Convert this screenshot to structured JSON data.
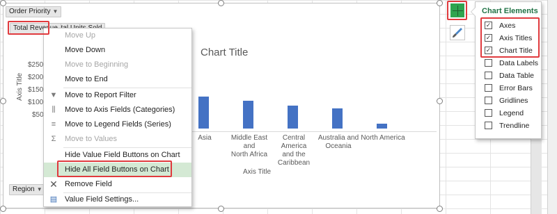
{
  "chart": {
    "title": "Chart Title",
    "y_axis_title": "Axis Title",
    "x_axis_title": "Axis Title",
    "y_ticks": [
      "$250",
      "$200",
      "$150",
      "$100",
      "$50"
    ],
    "field_buttons": {
      "order_priority": "Order Priority",
      "total_revenue": "Total Revenue",
      "total_units_sold": "Total Units Sold",
      "region": "Region"
    }
  },
  "chart_data": {
    "type": "bar",
    "title": "Chart Title",
    "xlabel": "Axis Title",
    "ylabel": "Axis Title",
    "categories": [
      "Asia",
      "Middle East and North Africa",
      "Central America and the Caribbean",
      "Australia and Oceania",
      "North America"
    ],
    "category_lines": [
      [
        "Asia"
      ],
      [
        "Middle East and",
        "North Africa"
      ],
      [
        "Central America",
        "and the",
        "Caribbean"
      ],
      [
        "Australia and",
        "Oceania"
      ],
      [
        "North America"
      ]
    ],
    "values": [
      120,
      105,
      85,
      75,
      18
    ],
    "ylim": [
      0,
      300
    ]
  },
  "context_menu": {
    "items": [
      {
        "label": "Move Up",
        "icon": "",
        "disabled": true
      },
      {
        "label": "Move Down",
        "icon": "",
        "disabled": false
      },
      {
        "label": "Move to Beginning",
        "icon": "",
        "disabled": true
      },
      {
        "label": "Move to End",
        "icon": "",
        "disabled": false
      },
      {
        "label": "Move to Report Filter",
        "icon": "filter-icon",
        "disabled": false
      },
      {
        "label": "Move to Axis Fields (Categories)",
        "icon": "axis-fields-icon",
        "disabled": false
      },
      {
        "label": "Move to Legend Fields (Series)",
        "icon": "legend-fields-icon",
        "disabled": false
      },
      {
        "label": "Move to Values",
        "icon": "sigma-icon",
        "disabled": true
      },
      {
        "label": "Hide Value Field Buttons on Chart",
        "icon": "",
        "disabled": false
      },
      {
        "label": "Hide All Field Buttons on Chart",
        "icon": "",
        "disabled": false,
        "highlighted": true
      },
      {
        "label": "Remove Field",
        "icon": "remove-icon",
        "disabled": false
      },
      {
        "label": "Value Field Settings...",
        "icon": "field-settings-icon",
        "disabled": false
      }
    ]
  },
  "chart_elements_panel": {
    "title": "Chart Elements",
    "items": [
      {
        "label": "Axes",
        "checked": true
      },
      {
        "label": "Axis Titles",
        "checked": true
      },
      {
        "label": "Chart Title",
        "checked": true
      },
      {
        "label": "Data Labels",
        "checked": false
      },
      {
        "label": "Data Table",
        "checked": false
      },
      {
        "label": "Error Bars",
        "checked": false
      },
      {
        "label": "Gridlines",
        "checked": false
      },
      {
        "label": "Legend",
        "checked": false
      },
      {
        "label": "Trendline",
        "checked": false
      }
    ],
    "check_mark": "✓"
  },
  "colors": {
    "bar": "#4472c4",
    "highlight_border": "#e03a3e",
    "panel_title": "#217346",
    "plus_button": "#2fa44f"
  }
}
